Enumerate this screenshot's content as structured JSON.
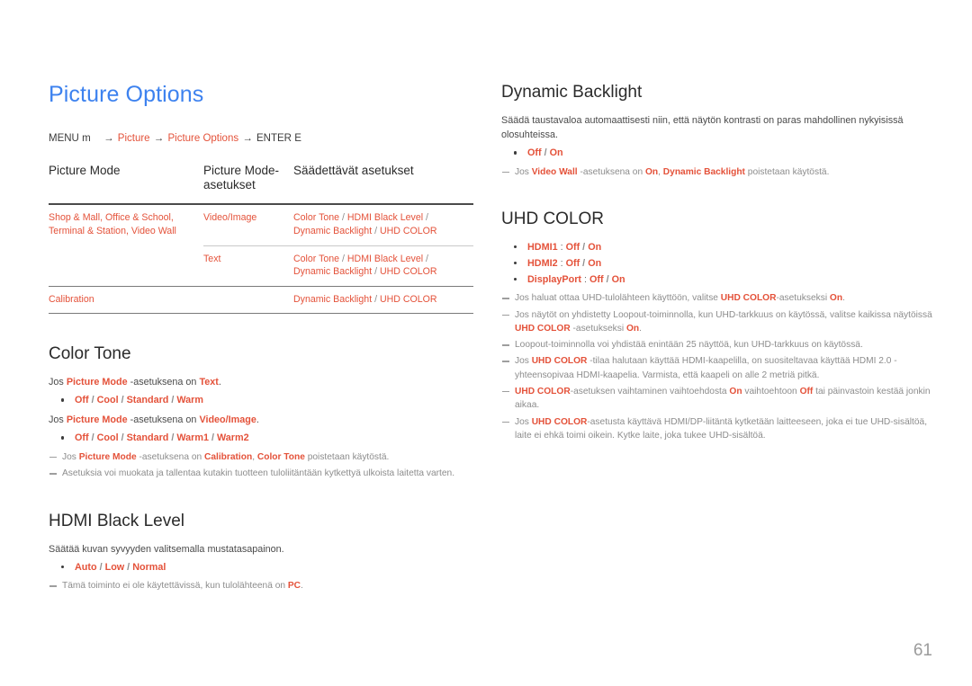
{
  "page": {
    "title": "Picture Options",
    "number": "61",
    "accent_color": "#e4523a",
    "title_color": "#3d82ef",
    "note_color": "#8c8c8c"
  },
  "breadcrumb": {
    "menu": "MENU",
    "menu_key": "m",
    "arrow": "→",
    "step1": "Picture",
    "step2": "Picture Options",
    "enter": "ENTER",
    "enter_key": "E"
  },
  "modes_table": {
    "headers": [
      "Picture Mode",
      "Picture Mode-asetukset",
      "Säädettävät asetukset"
    ],
    "rows": [
      {
        "mode": "Shop & Mall, Office & School, Terminal & Station, Video Wall",
        "mode_line1": "Shop & Mall, Office & School,",
        "mode_line2": "Terminal & Station, Video Wall",
        "submode": "Video/Image",
        "settings_line1": [
          "Color Tone",
          "HDMI Black Level"
        ],
        "settings_line2": [
          "Dynamic Backlight",
          "UHD COLOR"
        ]
      },
      {
        "mode": "",
        "mode_line1": "",
        "mode_line2": "",
        "submode": "Text",
        "settings_line1": [
          "Color Tone",
          "HDMI Black Level"
        ],
        "settings_line2": [
          "Dynamic Backlight",
          "UHD COLOR"
        ]
      },
      {
        "mode": "Calibration",
        "mode_line1": "Calibration",
        "mode_line2": "",
        "submode": "",
        "settings_line1": [
          "Dynamic Backlight",
          "UHD COLOR"
        ],
        "settings_line2": []
      }
    ]
  },
  "color_tone": {
    "title": "Color Tone",
    "intro1_pre": "Jos ",
    "intro1_a": "Picture Mode",
    "intro1_mid": " -asetuksena on ",
    "intro1_b": "Text",
    "intro1_post": ".",
    "options1": "Off / Cool / Standard / Warm",
    "options1_list": [
      "Off",
      "Cool",
      "Standard",
      "Warm"
    ],
    "intro2_pre": "Jos ",
    "intro2_a": "Picture Mode",
    "intro2_mid": " -asetuksena on ",
    "intro2_b": "Video/Image",
    "intro2_post": ".",
    "options2": "Off / Cool / Standard / Warm1 / Warm2",
    "options2_list": [
      "Off",
      "Cool",
      "Standard",
      "Warm1",
      "Warm2"
    ],
    "note1_pre": "Jos ",
    "note1_a": "Picture Mode",
    "note1_mid": " -asetuksena on ",
    "note1_b": "Calibration",
    "note1_mid2": ", ",
    "note1_c": "Color Tone",
    "note1_post": " poistetaan käytöstä.",
    "note2": "Asetuksia voi muokata ja tallentaa kutakin tuotteen tuloliitäntään kytkettyä ulkoista laitetta varten."
  },
  "hdmi_black_level": {
    "title": "HDMI Black Level",
    "description": "Säätää kuvan syvyyden valitsemalla mustatasapainon.",
    "options": "Auto / Low / Normal",
    "options_list": [
      "Auto",
      "Low",
      "Normal"
    ],
    "note_pre": "Tämä toiminto ei ole käytettävissä, kun tulolähteenä on ",
    "note_a": "PC",
    "note_post": "."
  },
  "dynamic_backlight": {
    "title": "Dynamic Backlight",
    "description": "Säädä taustavaloa automaattisesti niin, että näytön kontrasti on paras mahdollinen nykyisissä olosuhteissa.",
    "options": "Off / On",
    "options_list": [
      "Off",
      "On"
    ],
    "note_pre": "Jos ",
    "note_a": "Video Wall",
    "note_mid": " -asetuksena on ",
    "note_b": "On",
    "note_mid2": ", ",
    "note_c": "Dynamic Backlight",
    "note_post": " poistetaan käytöstä."
  },
  "uhd_color": {
    "title": "UHD COLOR",
    "options": [
      {
        "label": "HDMI1",
        "values": "Off / On",
        "values_list": [
          "Off",
          "On"
        ]
      },
      {
        "label": "HDMI2",
        "values": "Off / On",
        "values_list": [
          "Off",
          "On"
        ]
      },
      {
        "label": "DisplayPort",
        "values": "Off / On",
        "values_list": [
          "Off",
          "On"
        ]
      }
    ],
    "note1_pre": "Jos haluat ottaa UHD-tulolähteen käyttöön, valitse ",
    "note1_a": "UHD COLOR",
    "note1_mid": "-asetukseksi ",
    "note1_b": "On",
    "note1_post": ".",
    "note2_pre": "Jos näytöt on yhdistetty Loopout-toiminnolla, kun UHD-tarkkuus on käytössä, valitse kaikissa näytöissä ",
    "note2_a": "UHD COLOR",
    "note2_mid": " -asetukseksi ",
    "note2_b": "On",
    "note2_post": ".",
    "note3": "Loopout-toiminnolla voi yhdistää enintään 25 näyttöä, kun UHD-tarkkuus on käytössä.",
    "note4_pre": "Jos ",
    "note4_a": "UHD COLOR",
    "note4_post": " -tilaa halutaan käyttää HDMI-kaapelilla, on suositeltavaa käyttää HDMI 2.0 -yhteensopivaa HDMI-kaapelia. Varmista, että kaapeli on alle 2 metriä pitkä.",
    "note5_a": "UHD COLOR",
    "note5_mid": "-asetuksen vaihtaminen vaihtoehdosta ",
    "note5_b": "On",
    "note5_mid2": " vaihtoehtoon ",
    "note5_c": "Off",
    "note5_post": " tai päinvastoin kestää jonkin aikaa.",
    "note6_pre": "Jos ",
    "note6_a": "UHD COLOR",
    "note6_post": "-asetusta käyttävä HDMI/DP-liitäntä kytketään laitteeseen, joka ei tue UHD-sisältöä, laite ei ehkä toimi oikein. Kytke laite, joka tukee UHD-sisältöä."
  }
}
